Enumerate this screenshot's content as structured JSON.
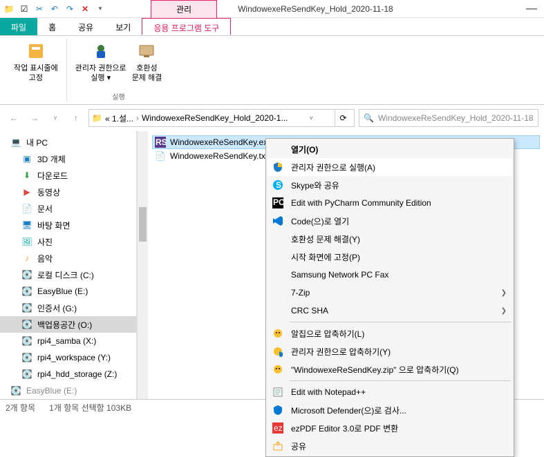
{
  "window": {
    "management_tab": "관리",
    "title": "WindowexeReSendKey_Hold_2020-11-18"
  },
  "ribbon_tabs": {
    "file": "파일",
    "home": "홈",
    "share": "공유",
    "view": "보기",
    "app_tools": "응용 프로그램 도구"
  },
  "ribbon": {
    "pin_taskbar": "작업 표시줄에\n고정",
    "run_admin": "관리자 권한으로\n실행 ▾",
    "compat": "호환성\n문제 해결",
    "group_run": "실행"
  },
  "nav": {
    "crumb1": "« 1.설...",
    "crumb2": "WindowexeReSendKey_Hold_2020-1...",
    "search_placeholder": "WindowexeReSendKey_Hold_2020-11-18"
  },
  "tree": {
    "pc": "내 PC",
    "objects3d": "3D 개체",
    "downloads": "다운로드",
    "videos": "동영상",
    "documents": "문서",
    "desktop": "바탕 화면",
    "pictures": "사진",
    "music": "음악",
    "localdisk": "로컬 디스크 (C:)",
    "easyblue": "EasyBlue (E:)",
    "cert": "인증서 (G:)",
    "backup": "백업용공간 (O:)",
    "rpi4_samba": "rpi4_samba (X:)",
    "rpi4_workspace": "rpi4_workspace (Y:)",
    "rpi4_hdd": "rpi4_hdd_storage (Z:)",
    "easyblue2": "EasyBlue (E:)"
  },
  "files": {
    "item1": "WindowexeReSendKey.exe",
    "item2": "WindowexeReSendKey.txt"
  },
  "context_menu": {
    "open": "열기(O)",
    "run_admin": "관리자 권한으로 실행(A)",
    "skype": "Skype와 공유",
    "pycharm": "Edit with PyCharm Community Edition",
    "code": "Code(으)로 열기",
    "compat": "호환성 문제 해결(Y)",
    "pin_start": "시작 화면에 고정(P)",
    "samsung_fax": "Samsung Network PC Fax",
    "seven_zip": "7-Zip",
    "crc_sha": "CRC SHA",
    "alzip": "알집으로 압축하기(L)",
    "admin_zip": "관리자 권한으로 압축하기(Y)",
    "zip_as": "\"WindowexeReSendKey.zip\" 으로 압축하기(Q)",
    "notepadpp": "Edit with Notepad++",
    "defender": "Microsoft Defender(으)로 검사...",
    "ezpdf": "ezPDF Editor 3.0로 PDF 변환",
    "share": "공유"
  },
  "status": {
    "count": "2개 항목",
    "selected": "1개 항목 선택함 103KB"
  }
}
